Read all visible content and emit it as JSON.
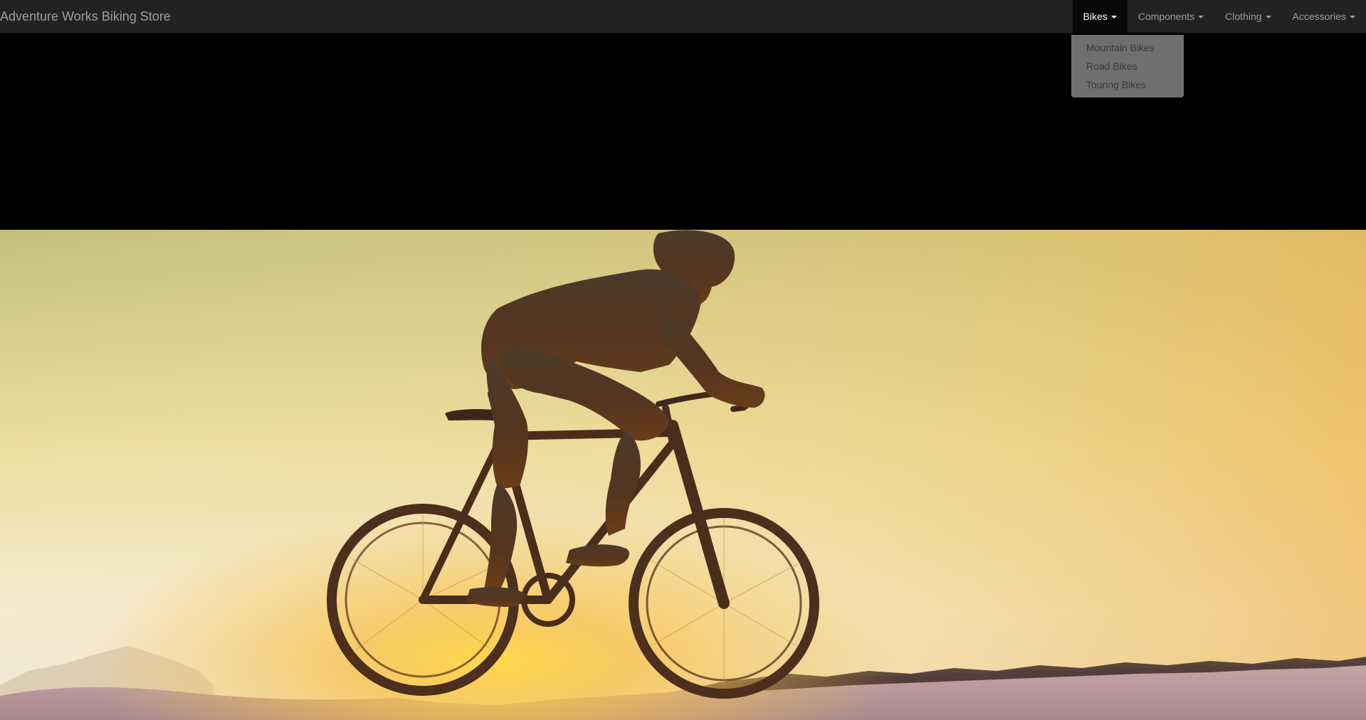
{
  "brand": "Adventure Works Biking Store",
  "nav": {
    "items": [
      {
        "label": "Bikes",
        "open": true
      },
      {
        "label": "Components",
        "open": false
      },
      {
        "label": "Clothing",
        "open": false
      },
      {
        "label": "Accessories",
        "open": false
      }
    ],
    "bikes_menu": [
      "Mountain Bikes",
      "Road Bikes",
      "Touring Bikes"
    ]
  },
  "colors": {
    "navbar_bg": "#222222",
    "nav_text": "#9d9d9d",
    "nav_active_bg": "#080808",
    "dropdown_bg": "#6f6f6f",
    "hero_sky_top": "#c9c27e",
    "hero_glow": "#f3c24a"
  },
  "hero": {
    "icon": "cyclist-silhouette-at-sunset-image"
  }
}
